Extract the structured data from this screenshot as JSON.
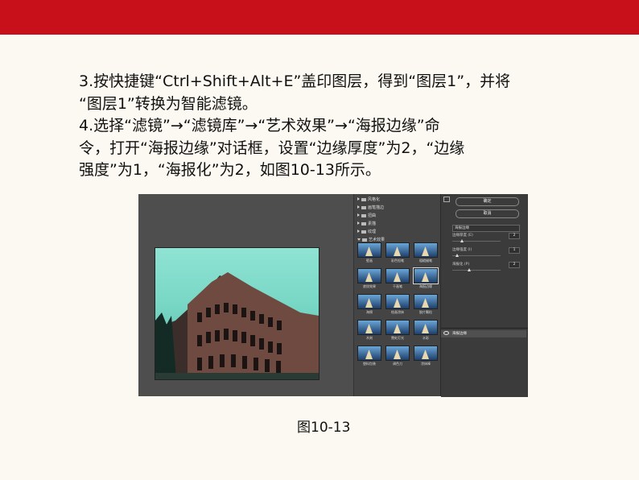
{
  "instructions": {
    "line1": "3.按快捷键“Ctrl+Shift+Alt+E”盖印图层，得到“图层1”，并将",
    "line2": "“图层1”转换为智能滤镜。",
    "line3": "4.选择“滤镜”→“滤镜库”→“艺术效果”→“海报边缘”命",
    "line4": "令，打开“海报边缘”对话框，设置“边缘厚度”为2，“边缘",
    "line5": "强度”为1，“海报化”为2，如图10-13所示。"
  },
  "dialog": {
    "categories": [
      "风格化",
      "画笔描边",
      "扭曲",
      "素描",
      "纹理"
    ],
    "open_category": "艺术效果",
    "filters": [
      "壁画",
      "彩色铅笔",
      "粗糙蜡笔",
      "底纹效果",
      "干画笔",
      "海报边缘",
      "海绵",
      "绘画涂抹",
      "胶片颗粒",
      "木刻",
      "霓虹灯光",
      "水彩",
      "塑料包装",
      "调色刀",
      "涂抹棒"
    ],
    "selected_filter": "海报边缘",
    "ok_label": "确定",
    "cancel_label": "取消",
    "filter_select": "海报边缘",
    "params": [
      {
        "label": "边缘厚度 (E)",
        "value": "2",
        "fraction": 0.2
      },
      {
        "label": "边缘强度 (I)",
        "value": "1",
        "fraction": 0.1
      },
      {
        "label": "海报化 (P)",
        "value": "2",
        "fraction": 0.35
      }
    ],
    "layer_name": "海报边缘"
  },
  "caption": "图10-13",
  "colors": {
    "brand_red": "#c8101b"
  }
}
